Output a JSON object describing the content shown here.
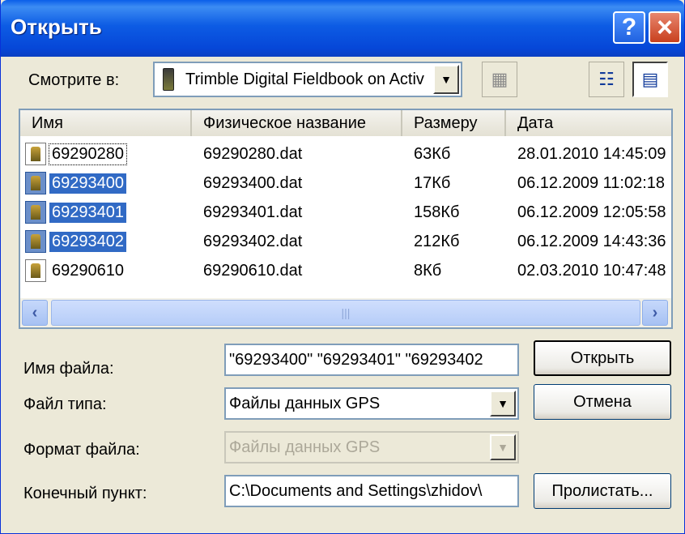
{
  "window": {
    "title": "Открыть"
  },
  "lookin": {
    "label": "Смотрите в:",
    "value": "Trimble Digital Fieldbook on Activ"
  },
  "columns": [
    "Имя",
    "Физическое название",
    "Размеру",
    "Дата"
  ],
  "files": [
    {
      "name": "69290280",
      "physical": "69290280.dat",
      "size": "63Кб",
      "date": "28.01.2010 14:45:09",
      "selected": false
    },
    {
      "name": "69293400",
      "physical": "69293400.dat",
      "size": "17Кб",
      "date": "06.12.2009 11:02:18",
      "selected": true
    },
    {
      "name": "69293401",
      "physical": "69293401.dat",
      "size": "158Кб",
      "date": "06.12.2009 12:05:58",
      "selected": true
    },
    {
      "name": "69293402",
      "physical": "69293402.dat",
      "size": "212Кб",
      "date": "06.12.2009 14:43:36",
      "selected": true
    },
    {
      "name": "69290610",
      "physical": "69290610.dat",
      "size": "8Кб",
      "date": "02.03.2010 10:47:48",
      "selected": false
    }
  ],
  "filename": {
    "label": "Имя файла:",
    "value": "\"69293400\" \"69293401\" \"69293402"
  },
  "filetype": {
    "label": "Файл типа:",
    "value": "Файлы данных GPS"
  },
  "fileformat": {
    "label": "Формат файла:",
    "value": "Файлы данных GPS"
  },
  "destination": {
    "label": "Конечный пункт:",
    "value": "C:\\Documents and Settings\\zhidov\\"
  },
  "buttons": {
    "open": "Открыть",
    "cancel": "Отмена",
    "browse": "Пролистать..."
  }
}
